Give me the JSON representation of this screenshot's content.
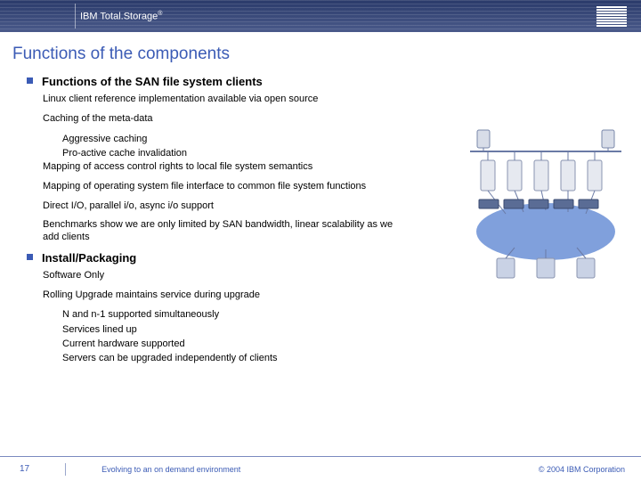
{
  "header": {
    "brand_html": "IBM Total.Storage",
    "reg": "®"
  },
  "title": "Functions of the components",
  "section1": {
    "heading": "Functions of the SAN file system clients",
    "items": [
      {
        "text": "Linux client reference implementation available via open source"
      },
      {
        "text": "Caching of the meta-data",
        "sub": [
          "Aggressive caching",
          "Pro-active cache invalidation"
        ]
      },
      {
        "text": "Mapping of access control rights to local file system semantics"
      },
      {
        "text": "Mapping of operating system file interface to common file system functions"
      },
      {
        "text": "Direct I/O, parallel i/o, async i/o support"
      },
      {
        "text": "Benchmarks show we are only limited by SAN bandwidth, linear scalability as we add clients"
      }
    ]
  },
  "section2": {
    "heading": "Install/Packaging",
    "items": [
      {
        "text": "Software Only"
      },
      {
        "text": "Rolling Upgrade maintains service during upgrade",
        "sub": [
          "N and n-1 supported simultaneously",
          "Services lined up",
          "Current hardware supported",
          "Servers can be upgraded independently of clients"
        ]
      }
    ]
  },
  "footer": {
    "page": "17",
    "tagline": "Evolving to an on demand environment",
    "copyright": "© 2004 IBM Corporation"
  }
}
